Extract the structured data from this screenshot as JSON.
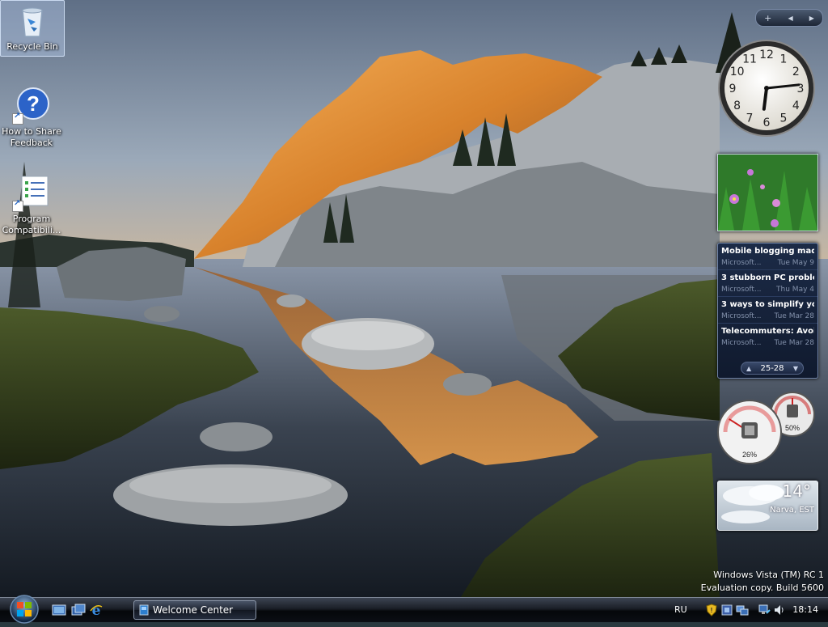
{
  "desktop": {
    "icons": [
      {
        "label": "Recycle Bin"
      },
      {
        "label_line1": "How to Share",
        "label_line2": "Feedback"
      },
      {
        "label_line1": "Program",
        "label_line2": "Compatibili..."
      }
    ]
  },
  "sidebar": {
    "controls": {
      "add": "+",
      "prev": "◀",
      "next": "▶"
    },
    "clock": {
      "hour": 18,
      "minute": 14,
      "numerals": [
        "12",
        "1",
        "2",
        "3",
        "4",
        "5",
        "6",
        "7",
        "8",
        "9",
        "10",
        "11"
      ]
    },
    "feeds": {
      "items": [
        {
          "title": "Mobile blogging mad...",
          "source": "Microsoft...",
          "date": "Tue May 9"
        },
        {
          "title": "3 stubborn PC proble...",
          "source": "Microsoft...",
          "date": "Thu May 4"
        },
        {
          "title": "3 ways to simplify yo...",
          "source": "Microsoft...",
          "date": "Tue Mar 28"
        },
        {
          "title": "Telecommuters: Avoi...",
          "source": "Microsoft...",
          "date": "Tue Mar 28"
        }
      ],
      "page": "25-28"
    },
    "meters": {
      "cpu": "26%",
      "memory": "50%",
      "cpu_fraction": 0.26,
      "memory_fraction": 0.5
    },
    "weather": {
      "temp": "14°",
      "city": "Narva, EST"
    }
  },
  "watermark": {
    "line1": "Windows Vista (TM) RC 1",
    "line2": "Evaluation copy. Build 5600"
  },
  "taskbar": {
    "task_button": "Welcome Center",
    "language": "RU",
    "time": "18:14"
  }
}
